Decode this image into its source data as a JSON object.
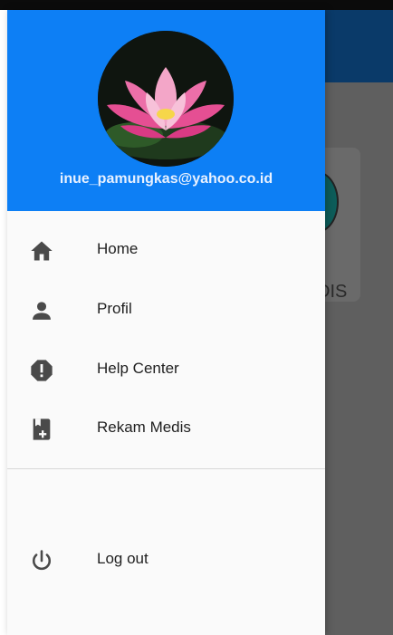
{
  "header": {
    "email": "inue_pamungkas@yahoo.co.id",
    "avatar_desc": "pink-lotus-flower-image"
  },
  "menu": {
    "items": [
      {
        "label": "Home",
        "icon": "home-icon"
      },
      {
        "label": "Profil",
        "icon": "person-icon"
      },
      {
        "label": "Help Center",
        "icon": "alert-octagon-icon"
      },
      {
        "label": "Rekam Medis",
        "icon": "medical-record-icon"
      }
    ],
    "logout": {
      "label": "Log out",
      "icon": "power-icon"
    }
  },
  "background": {
    "card_text": "DIS"
  },
  "colors": {
    "header": "#0d7ff5",
    "drawer_bg": "#fafafa",
    "icon": "#4a4a4a",
    "appbar": "#0a3a69",
    "scrim": "#5f5f5f"
  }
}
